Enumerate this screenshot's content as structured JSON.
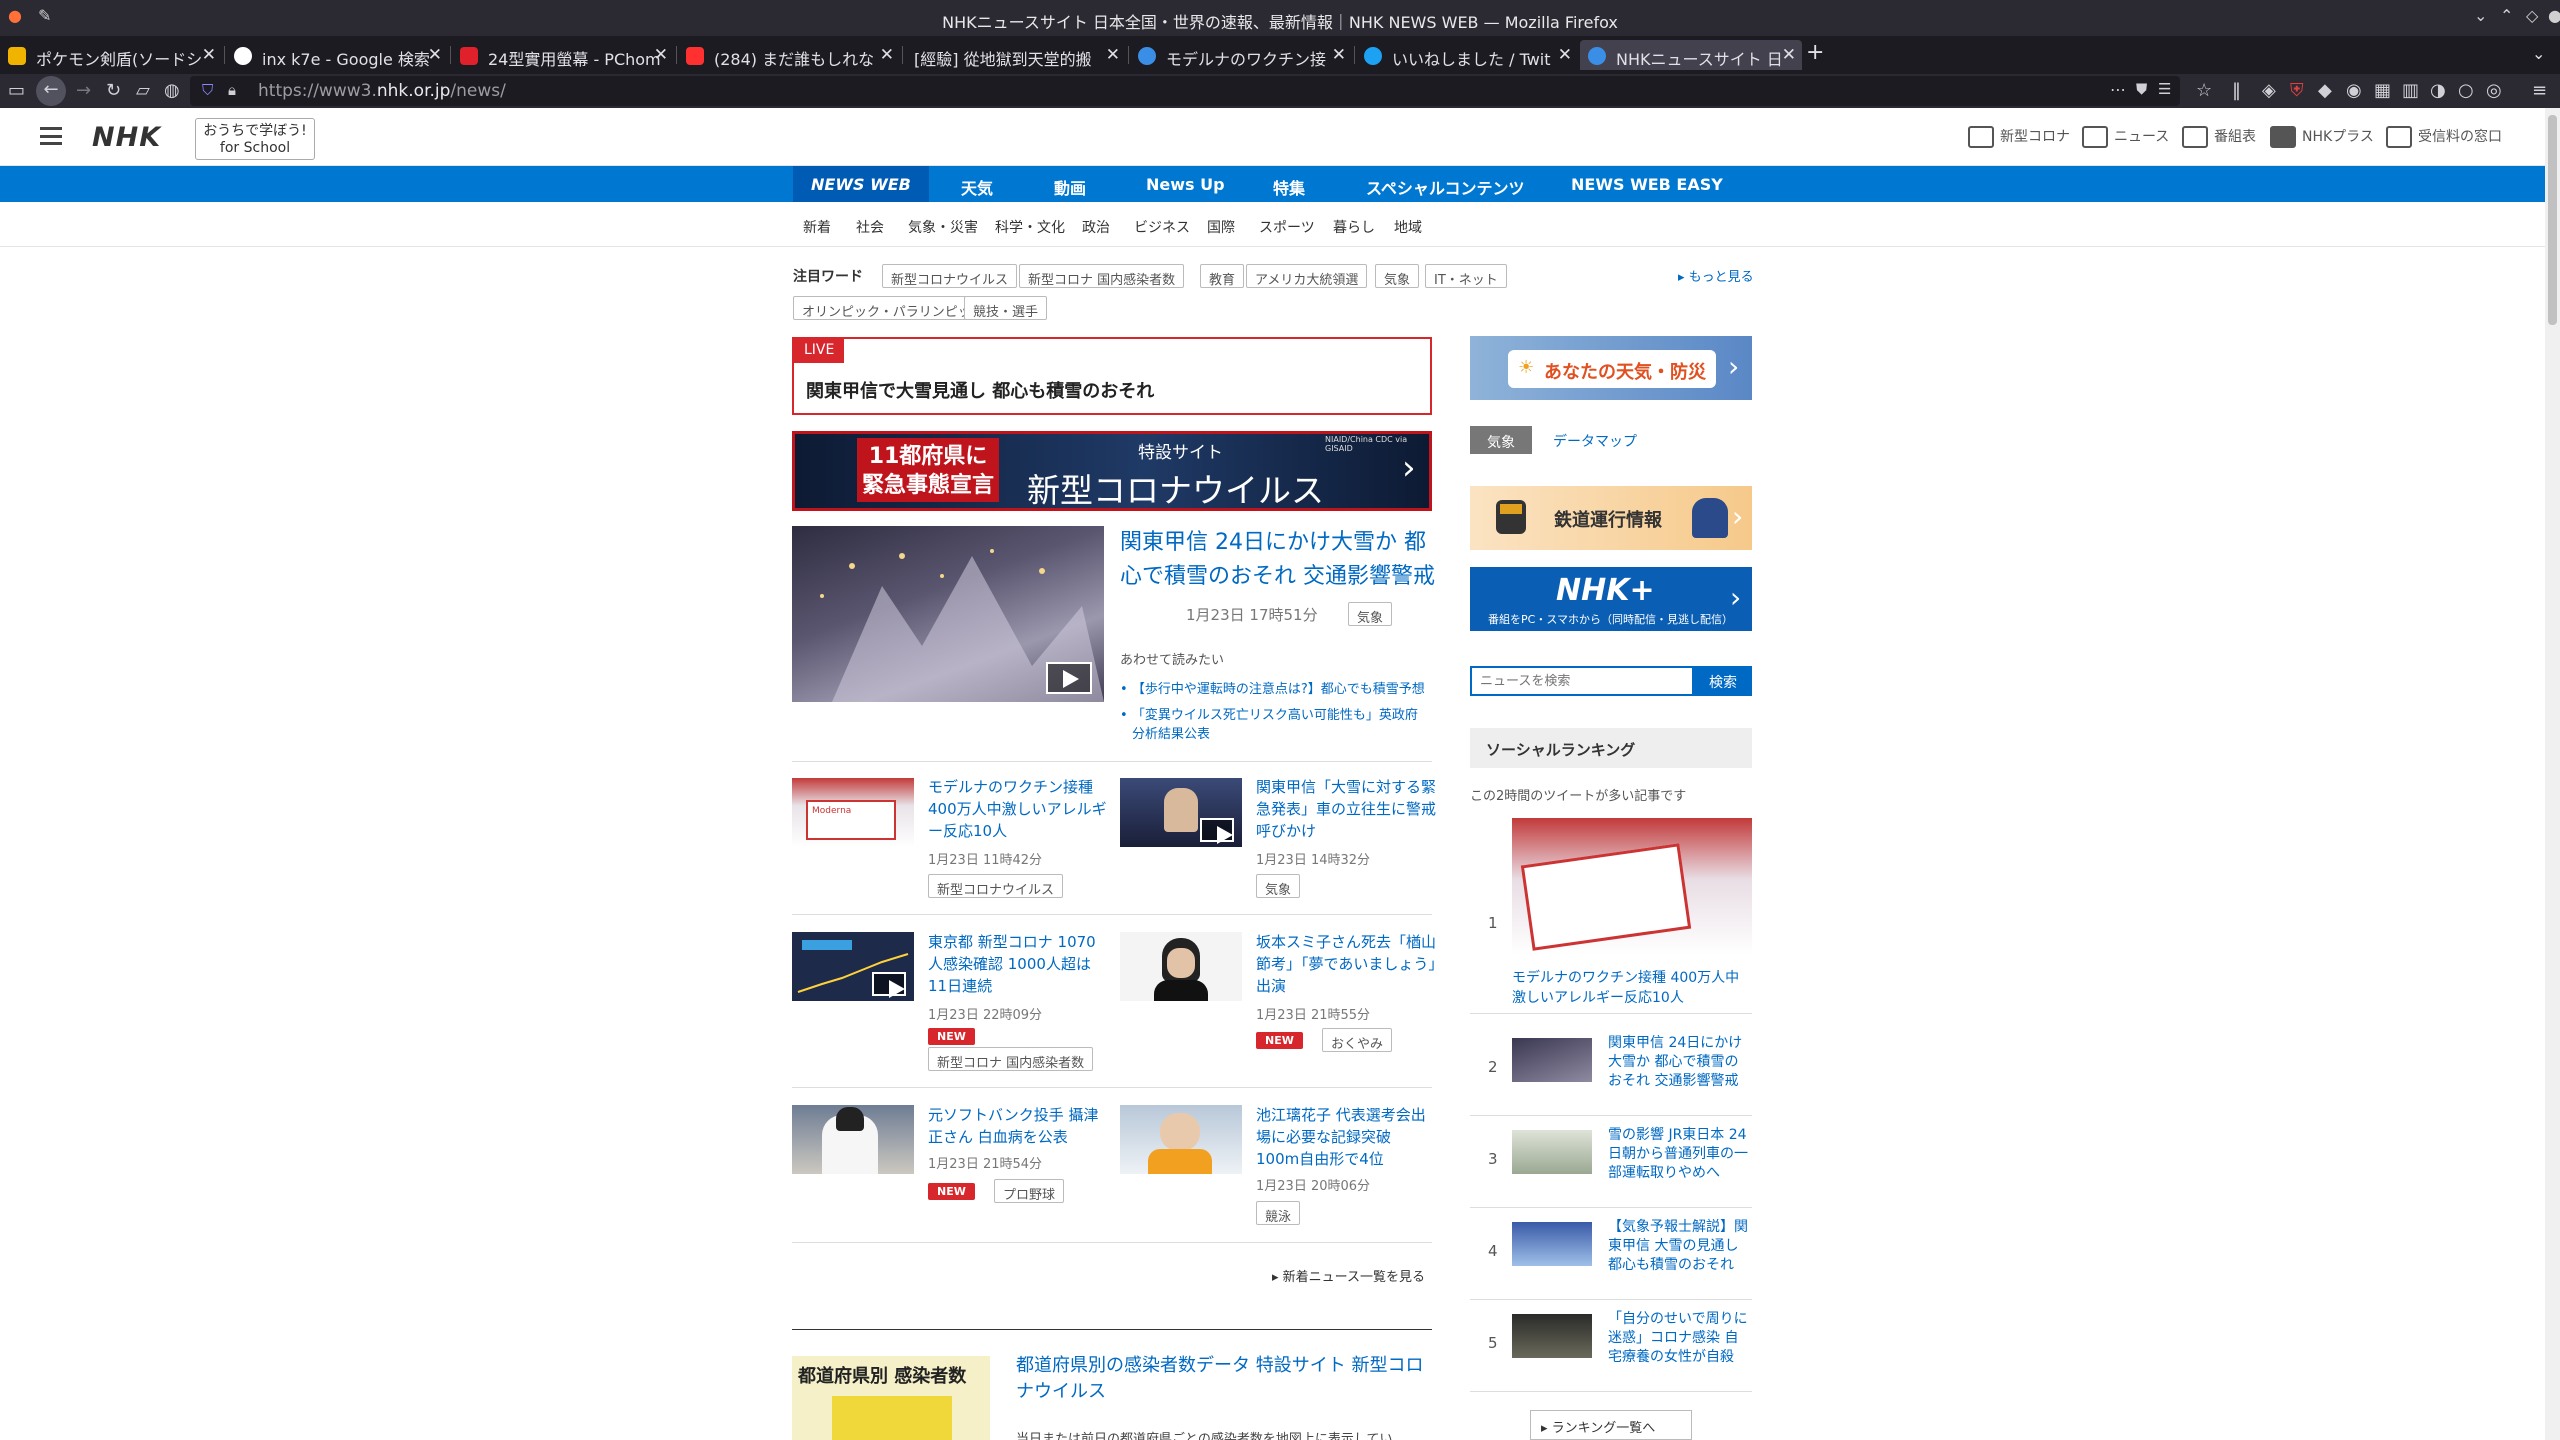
{
  "window": {
    "title": "NHKニュースサイト 日本全国・世界の速報、最新情報｜NHK NEWS WEB — Mozilla Firefox"
  },
  "tabs": [
    {
      "label": "ポケモン剣盾(ソードシ",
      "favicon_color": "#f0b400"
    },
    {
      "label": "inx k7e - Google 検索",
      "favicon_color": "#ffffff"
    },
    {
      "label": "24型實用螢幕 - PChom",
      "favicon_color": "#e0202a"
    },
    {
      "label": "(284) まだ誰もしれな",
      "favicon_color": "#ff3030"
    },
    {
      "label": "[經驗] 從地獄到天堂的搬",
      "favicon_color": "#1c1b22"
    },
    {
      "label": "モデルナのワクチン接",
      "favicon_color": "#3a8ee6"
    },
    {
      "label": "いいねしました / Twit",
      "favicon_color": "#1da1f2"
    },
    {
      "label": "NHKニュースサイト 日",
      "favicon_color": "#3a8ee6"
    }
  ],
  "browser": {
    "url_prefix": "https://www3.",
    "url_domain": "nhk.or.jp",
    "url_path": "/news/",
    "new_tab": "+"
  },
  "header": {
    "logo": "NHK",
    "school_line1": "おうちで学ぼう!",
    "school_line2": "for School",
    "links": [
      "新型コロナ",
      "ニュース",
      "番組表",
      "NHKプラス",
      "受信料の窓口"
    ]
  },
  "main_nav": [
    "NEWS WEB",
    "天気",
    "動画",
    "News Up",
    "特集",
    "スペシャルコンテンツ",
    "NEWS WEB EASY"
  ],
  "sub_nav": [
    "新着",
    "社会",
    "気象・災害",
    "科学・文化",
    "政治",
    "ビジネス",
    "国際",
    "スポーツ",
    "暮らし",
    "地域"
  ],
  "trending": {
    "label": "注目ワード",
    "tags": [
      "新型コロナウイルス",
      "新型コロナ 国内感染者数",
      "教育",
      "アメリカ大統領選",
      "気象",
      "IT・ネット",
      "オリンピック・パラリンピック",
      "競技・選手"
    ],
    "more": "もっと見る"
  },
  "live": {
    "badge": "LIVE",
    "headline": "関東甲信で大雪見通し 都心も積雪のおそれ"
  },
  "corona_banner": {
    "left_line1": "11都府県に",
    "left_line2": "緊急事態宣言",
    "small": "特設サイト",
    "big": "新型コロナウイルス",
    "credit": "NIAID/China CDC via GISAID",
    "arrow": "›"
  },
  "top_story": {
    "title": "関東甲信 24日にかけ大雪か 都心で積雪のおそれ 交通影響警戒",
    "date": "1月23日 17時51分",
    "tag": "気象",
    "related_label": "あわせて読みたい",
    "related": [
      "【歩行中や運転時の注意点は?】都心でも積雪予想",
      "「変異ウイルス死亡リスク高い可能性も」英政府 分析結果公表"
    ]
  },
  "news_grid": [
    {
      "title": "モデルナのワクチン接種 400万人中激しいアレルギー反応10人",
      "date": "1月23日 11時42分",
      "new": "",
      "tags": [
        "新型コロナウイルス"
      ]
    },
    {
      "title": "関東甲信「大雪に対する緊急発表」車の立往生に警戒呼びかけ",
      "date": "1月23日 14時32分",
      "new": "",
      "tags": [
        "気象"
      ]
    },
    {
      "title": "東京都 新型コロナ 1070人感染確認 1000人超は11日連続",
      "date": "1月23日 22時09分",
      "new": "NEW",
      "tags": [
        "新型コロナ 国内感染者数"
      ]
    },
    {
      "title": "坂本スミ子さん死去「楢山節考」「夢であいましょう」出演",
      "date": "1月23日 21時55分",
      "new": "NEW",
      "tags": [
        "おくやみ"
      ]
    },
    {
      "title": "元ソフトバンク投手 攝津正さん 白血病を公表",
      "date": "1月23日 21時54分",
      "new": "NEW",
      "tags": [
        "プロ野球"
      ]
    },
    {
      "title": "池江璃花子 代表選考会出場に必要な記録突破 100m自由形で4位",
      "date": "1月23日 20時06分",
      "new": "",
      "tags": [
        "競泳"
      ]
    }
  ],
  "more_news": "新着ニュース一覧を見る",
  "special": {
    "thumb_text": "都道府県別 感染者数",
    "title": "都道府県別の感染者数データ 特設サイト 新型コロナウイルス",
    "desc": "当日または前日の都道府県ごとの感染者数を地図上に表示してい"
  },
  "sidebar": {
    "weather_banner": "あなたの天気・防災",
    "weather_tabs": [
      "気象",
      "データマップ"
    ],
    "train_banner": "鉄道運行情報",
    "nhkplus_logo": "NHK+",
    "nhkplus_sub": "番組をPC・スマホから（同時配信・見逃し配信）",
    "search_placeholder": "ニュースを検索",
    "search_button": "検索",
    "ranking_title": "ソーシャルランキング",
    "ranking_sub": "この2時間のツイートが多い記事です",
    "ranking": [
      {
        "rank": "1",
        "title": "モデルナのワクチン接種 400万人中激しいアレルギー反応10人"
      },
      {
        "rank": "2",
        "title": "関東甲信 24日にかけ大雪か 都心で積雪のおそれ 交通影響警戒"
      },
      {
        "rank": "3",
        "title": "雪の影響 JR東日本 24日朝から普通列車の一部運転取りやめへ"
      },
      {
        "rank": "4",
        "title": "【気象予報士解説】関東甲信 大雪の見通し 都心も積雪のおそれ"
      },
      {
        "rank": "5",
        "title": "「自分のせいで周りに迷惑」コロナ感染 自宅療養の女性が自殺"
      }
    ],
    "ranking_more": "ランキング一覧へ"
  },
  "colors": {
    "nhk_blue": "#0078d2",
    "link_blue": "#0069c3",
    "live_red": "#d8262d"
  }
}
